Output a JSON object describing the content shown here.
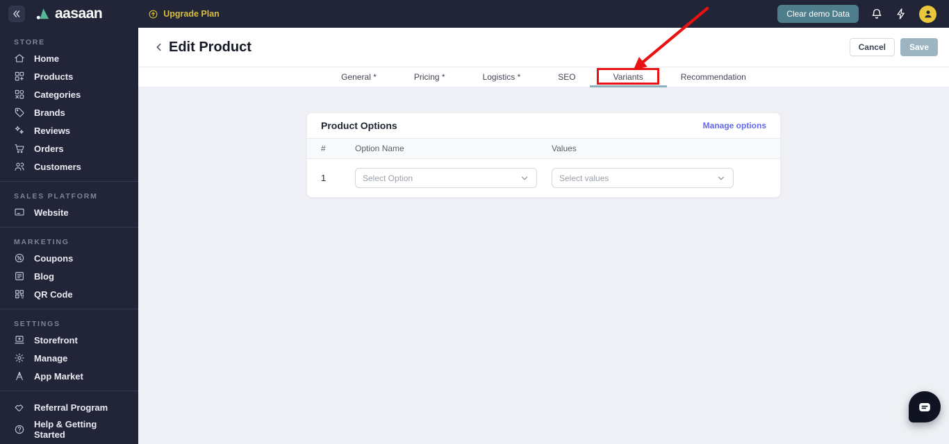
{
  "topbar": {
    "logo_text": "aasaan",
    "upgrade_label": "Upgrade Plan",
    "clear_demo_label": "Clear demo Data",
    "icons": [
      "collapse-icon",
      "upgrade-icon",
      "bell-icon",
      "bolt-icon",
      "avatar-person-icon"
    ]
  },
  "sidebar": {
    "sections": [
      {
        "title": "STORE",
        "items": [
          {
            "label": "Home",
            "icon": "home"
          },
          {
            "label": "Products",
            "icon": "products"
          },
          {
            "label": "Categories",
            "icon": "categories"
          },
          {
            "label": "Brands",
            "icon": "brands"
          },
          {
            "label": "Reviews",
            "icon": "reviews"
          },
          {
            "label": "Orders",
            "icon": "orders"
          },
          {
            "label": "Customers",
            "icon": "customers"
          }
        ]
      },
      {
        "title": "SALES PLATFORM",
        "items": [
          {
            "label": "Website",
            "icon": "website"
          }
        ]
      },
      {
        "title": "MARKETING",
        "items": [
          {
            "label": "Coupons",
            "icon": "coupons"
          },
          {
            "label": "Blog",
            "icon": "blog"
          },
          {
            "label": "QR Code",
            "icon": "qrcode"
          }
        ]
      },
      {
        "title": "SETTINGS",
        "items": [
          {
            "label": "Storefront",
            "icon": "storefront"
          },
          {
            "label": "Manage",
            "icon": "manage"
          },
          {
            "label": "App Market",
            "icon": "appmarket"
          }
        ]
      }
    ],
    "footer_items": [
      {
        "label": "Referral Program",
        "icon": "referral"
      },
      {
        "label": "Help & Getting Started",
        "icon": "help"
      }
    ]
  },
  "page": {
    "title": "Edit Product",
    "cancel_label": "Cancel",
    "save_label": "Save"
  },
  "tabs": {
    "items": [
      "General *",
      "Pricing *",
      "Logistics *",
      "SEO",
      "Variants",
      "Recommendation"
    ],
    "active": "Variants"
  },
  "product_options": {
    "title": "Product Options",
    "manage_label": "Manage options",
    "columns": [
      "#",
      "Option Name",
      "Values"
    ],
    "rows": [
      {
        "index": "1",
        "option_placeholder": "Select Option",
        "values_placeholder": "Select values"
      }
    ]
  },
  "annotation": {
    "type": "red-arrow-and-box",
    "target_tab": "Variants",
    "color": "#e91111"
  },
  "colors": {
    "topbar_bg": "#212537",
    "clear_demo_teal": "#4e7d8b",
    "upgrade_yellow": "#d9bd3c",
    "avatar_yellow": "#e9c63b",
    "link_purple": "#6468ee",
    "active_tab_underline": "#8cb0bc",
    "save_button_bg": "#9db5c0",
    "annotation_red": "#e91111",
    "content_bg": "#eef0f5"
  }
}
